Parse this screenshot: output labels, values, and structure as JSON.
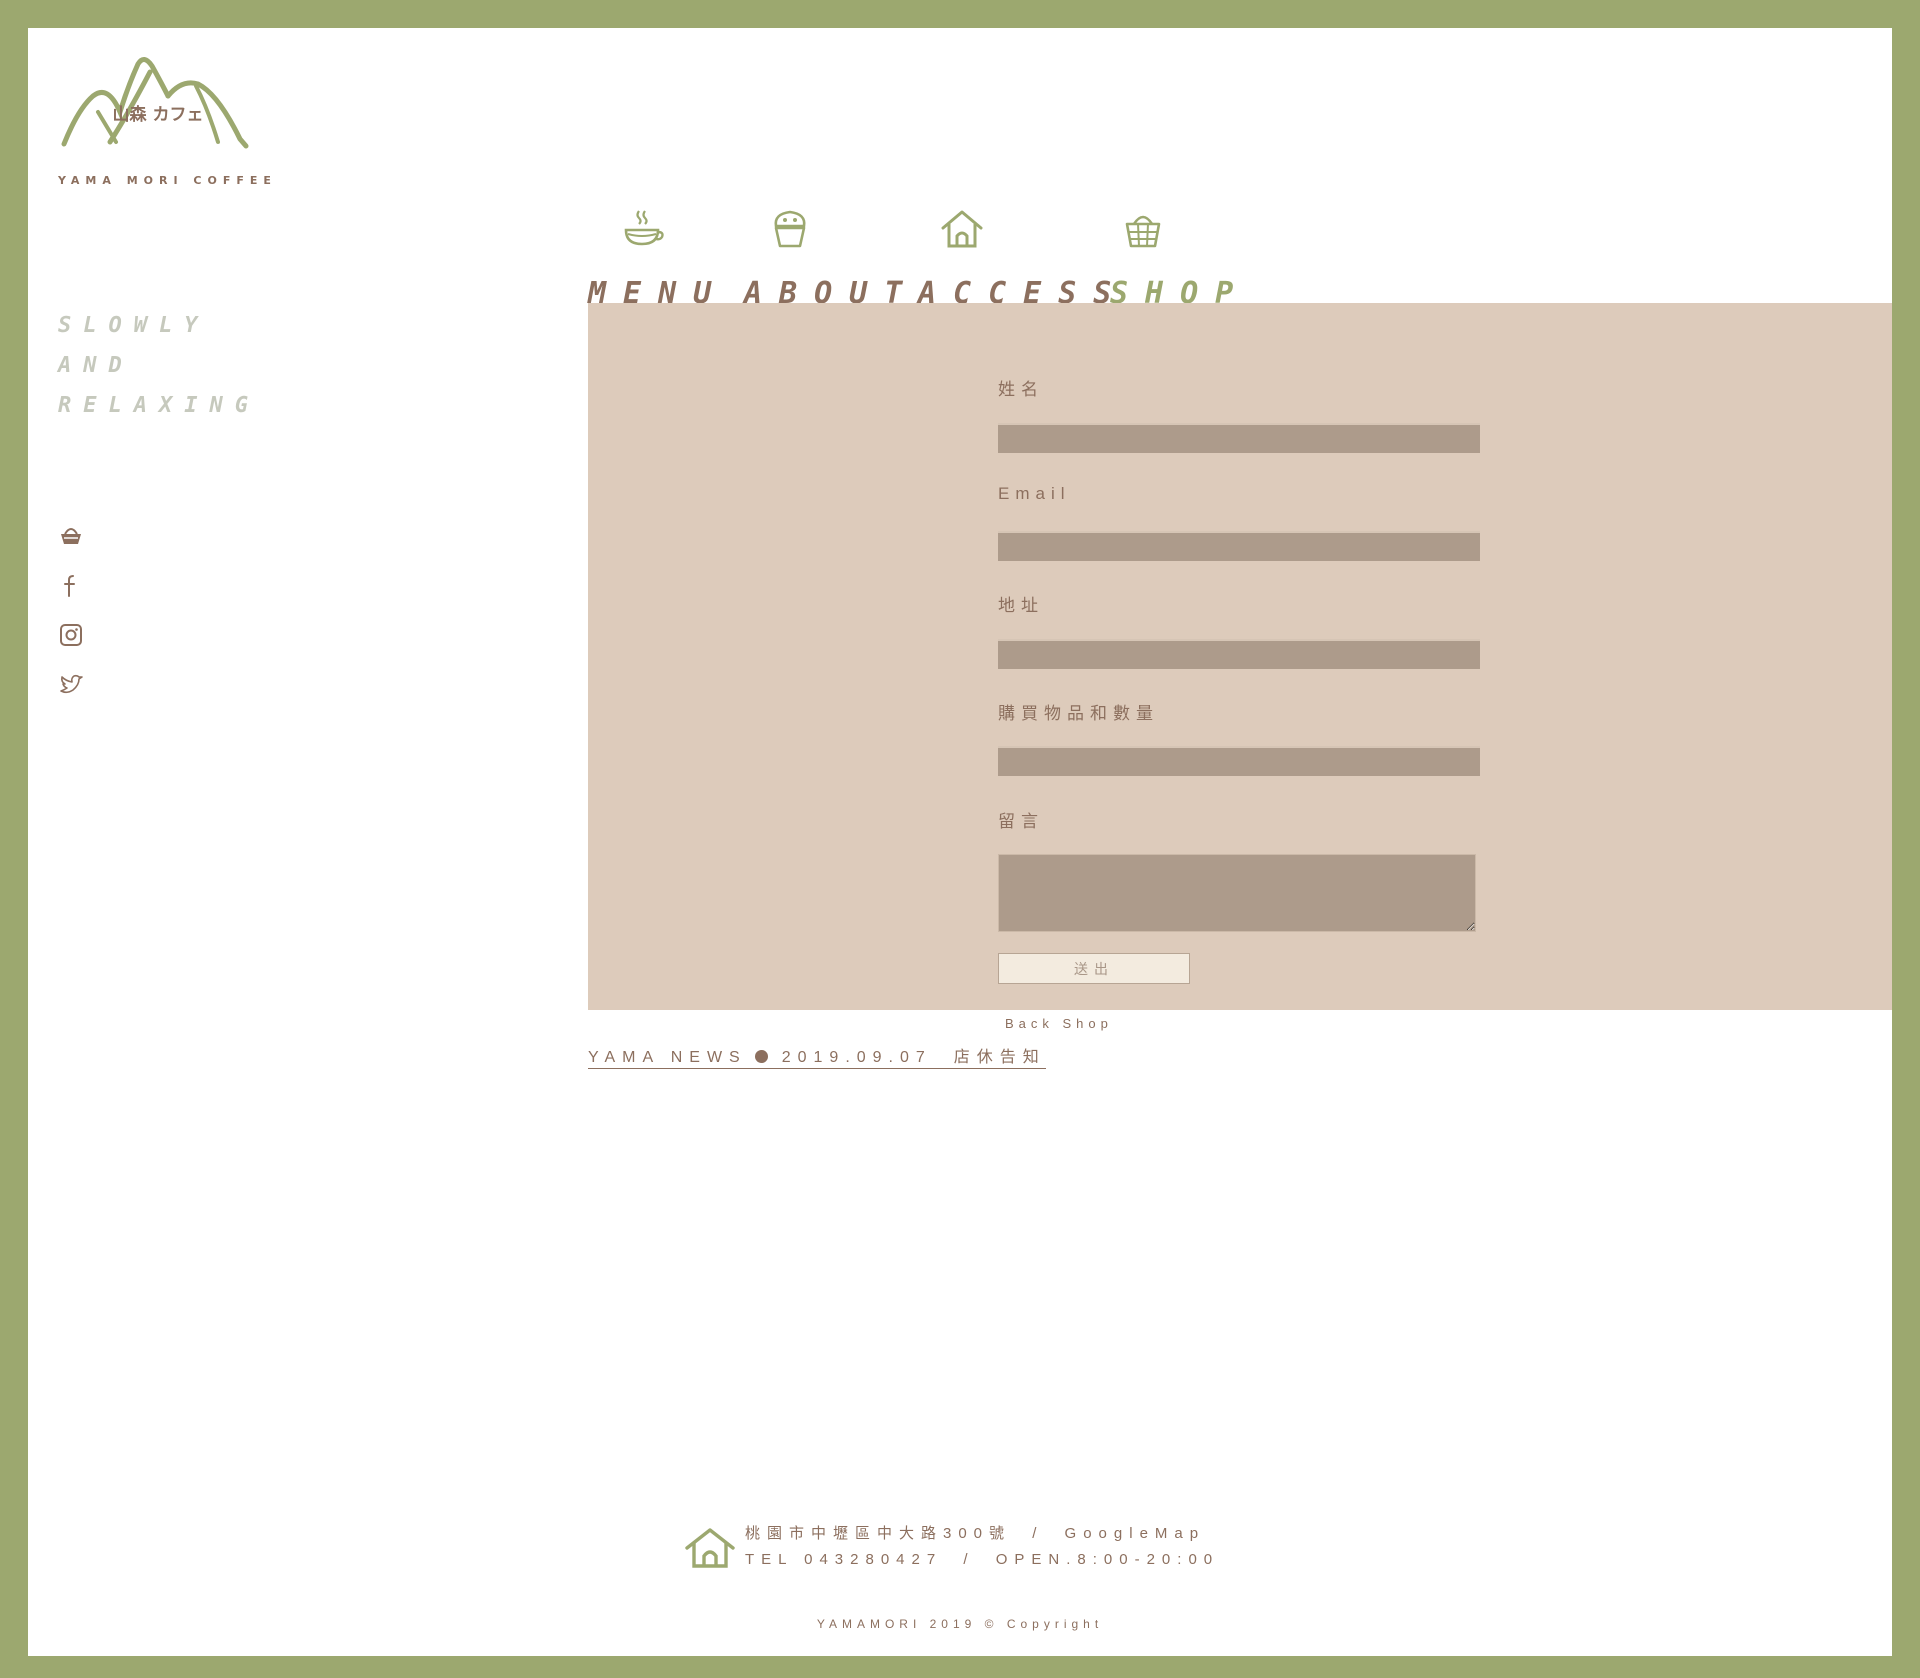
{
  "brand": {
    "logo_title": "山森 カフェ",
    "logo_subtitle": "YAMA MORI COFFEE"
  },
  "slogan": [
    "SLOWLY",
    "AND",
    "RELAXING"
  ],
  "social": [
    {
      "name": "shop-basket-icon"
    },
    {
      "name": "facebook-icon"
    },
    {
      "name": "instagram-icon"
    },
    {
      "name": "twitter-icon"
    }
  ],
  "nav": {
    "items": [
      {
        "label": "MENU",
        "icon": "coffee-cup-icon"
      },
      {
        "label": "ABOUT",
        "icon": "cupcake-icon"
      },
      {
        "label": "ACCESS",
        "icon": "house-icon"
      },
      {
        "label": "SHOP",
        "icon": "basket-icon",
        "active": true
      }
    ]
  },
  "form": {
    "fields": [
      {
        "label": "姓名",
        "value": ""
      },
      {
        "label": "Email",
        "value": ""
      },
      {
        "label": "地址",
        "value": ""
      },
      {
        "label": "購買物品和數量",
        "value": ""
      },
      {
        "label": "留言",
        "value": ""
      }
    ],
    "submit_label": "送出",
    "back_label": "Back Shop"
  },
  "news": {
    "label": "YAMA NEWS",
    "date": "2019.09.07",
    "title": "店休告知"
  },
  "footer": {
    "address": "桃園市中壢區中大路300號",
    "map_label": "GoogleMap",
    "tel": "TEL 043280427",
    "hours": "OPEN.8:00-20:00",
    "separator": "/",
    "copyright": "YAMAMORI 2019 © Copyright"
  },
  "colors": {
    "border_green": "#9ca86f",
    "brown": "#8c6f5e",
    "panel": "#ddcbbb",
    "input": "#ad9b8b"
  }
}
